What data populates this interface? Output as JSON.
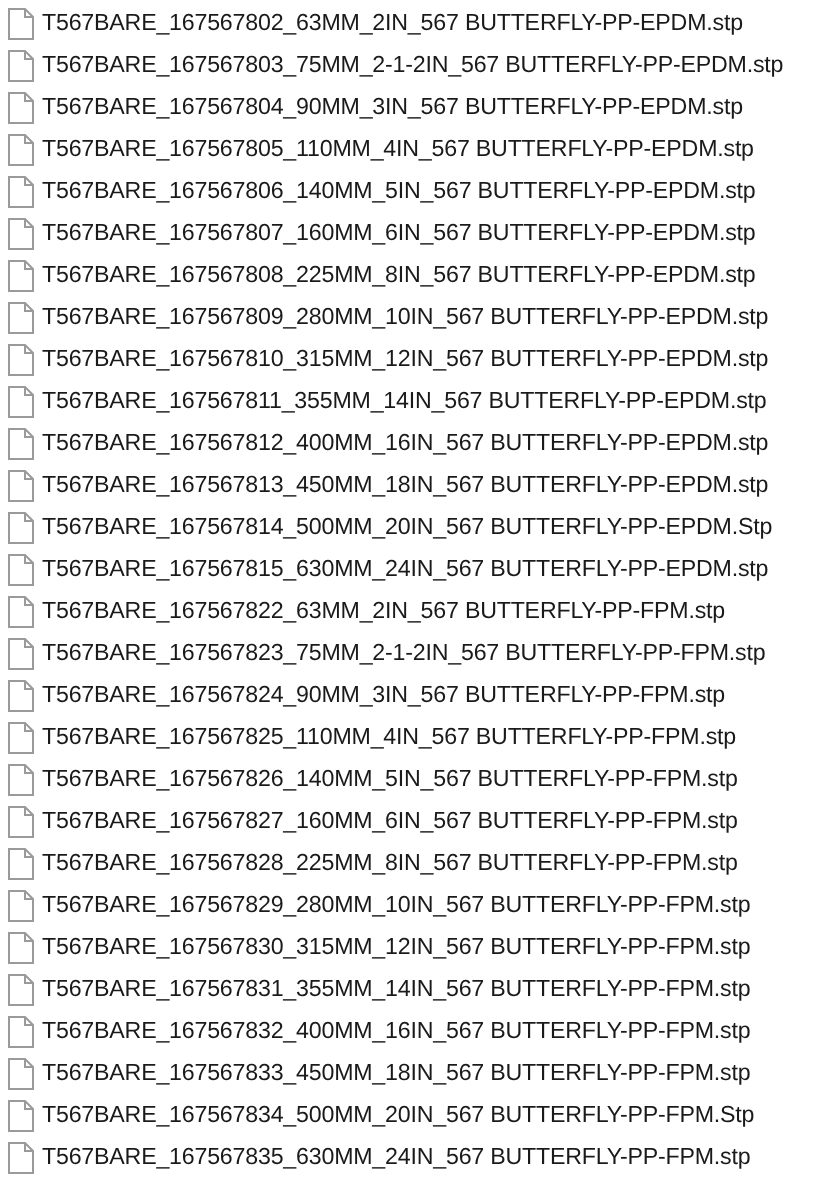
{
  "files": [
    {
      "name": "T567BARE_167567802_63MM_2IN_567 BUTTERFLY-PP-EPDM.stp"
    },
    {
      "name": "T567BARE_167567803_75MM_2-1-2IN_567 BUTTERFLY-PP-EPDM.stp"
    },
    {
      "name": "T567BARE_167567804_90MM_3IN_567 BUTTERFLY-PP-EPDM.stp"
    },
    {
      "name": "T567BARE_167567805_110MM_4IN_567 BUTTERFLY-PP-EPDM.stp"
    },
    {
      "name": "T567BARE_167567806_140MM_5IN_567 BUTTERFLY-PP-EPDM.stp"
    },
    {
      "name": "T567BARE_167567807_160MM_6IN_567 BUTTERFLY-PP-EPDM.stp"
    },
    {
      "name": "T567BARE_167567808_225MM_8IN_567 BUTTERFLY-PP-EPDM.stp"
    },
    {
      "name": "T567BARE_167567809_280MM_10IN_567 BUTTERFLY-PP-EPDM.stp"
    },
    {
      "name": "T567BARE_167567810_315MM_12IN_567 BUTTERFLY-PP-EPDM.stp"
    },
    {
      "name": "T567BARE_167567811_355MM_14IN_567 BUTTERFLY-PP-EPDM.stp"
    },
    {
      "name": "T567BARE_167567812_400MM_16IN_567 BUTTERFLY-PP-EPDM.stp"
    },
    {
      "name": "T567BARE_167567813_450MM_18IN_567 BUTTERFLY-PP-EPDM.stp"
    },
    {
      "name": "T567BARE_167567814_500MM_20IN_567 BUTTERFLY-PP-EPDM.Stp"
    },
    {
      "name": "T567BARE_167567815_630MM_24IN_567 BUTTERFLY-PP-EPDM.stp"
    },
    {
      "name": "T567BARE_167567822_63MM_2IN_567 BUTTERFLY-PP-FPM.stp"
    },
    {
      "name": "T567BARE_167567823_75MM_2-1-2IN_567 BUTTERFLY-PP-FPM.stp"
    },
    {
      "name": "T567BARE_167567824_90MM_3IN_567 BUTTERFLY-PP-FPM.stp"
    },
    {
      "name": "T567BARE_167567825_110MM_4IN_567 BUTTERFLY-PP-FPM.stp"
    },
    {
      "name": "T567BARE_167567826_140MM_5IN_567 BUTTERFLY-PP-FPM.stp"
    },
    {
      "name": "T567BARE_167567827_160MM_6IN_567 BUTTERFLY-PP-FPM.stp"
    },
    {
      "name": "T567BARE_167567828_225MM_8IN_567 BUTTERFLY-PP-FPM.stp"
    },
    {
      "name": "T567BARE_167567829_280MM_10IN_567 BUTTERFLY-PP-FPM.stp"
    },
    {
      "name": "T567BARE_167567830_315MM_12IN_567 BUTTERFLY-PP-FPM.stp"
    },
    {
      "name": "T567BARE_167567831_355MM_14IN_567 BUTTERFLY-PP-FPM.stp"
    },
    {
      "name": "T567BARE_167567832_400MM_16IN_567 BUTTERFLY-PP-FPM.stp"
    },
    {
      "name": "T567BARE_167567833_450MM_18IN_567 BUTTERFLY-PP-FPM.stp"
    },
    {
      "name": "T567BARE_167567834_500MM_20IN_567 BUTTERFLY-PP-FPM.Stp"
    },
    {
      "name": "T567BARE_167567835_630MM_24IN_567 BUTTERFLY-PP-FPM.stp"
    }
  ]
}
